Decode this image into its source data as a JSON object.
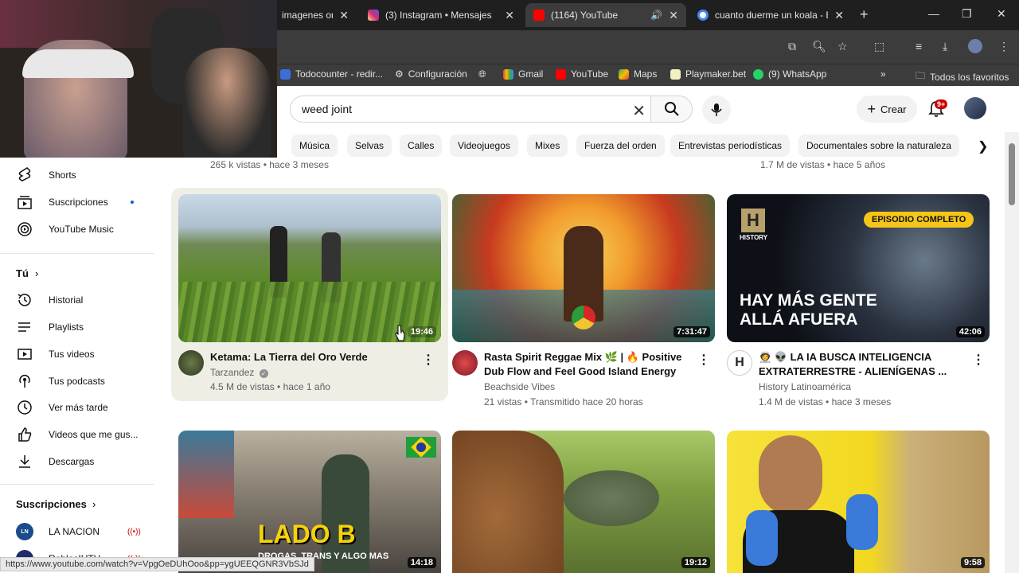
{
  "browser": {
    "tabs": [
      {
        "title": "imagenes or",
        "favicon": "image-favicon"
      },
      {
        "title": "(3) Instagram • Mensajes",
        "favicon": "instagram-favicon"
      },
      {
        "title": "(1164) YouTube",
        "favicon": "youtube-favicon"
      },
      {
        "title": "cuanto duerme un koala - B",
        "favicon": "google-favicon"
      }
    ],
    "bookmarks": [
      "Todocounter - redir...",
      "Configuración",
      "Gmail",
      "YouTube",
      "Maps",
      "Playmaker.bet",
      "(9) WhatsApp"
    ],
    "all_favorites": "Todos los favoritos",
    "status_url": "https://www.youtube.com/watch?v=VpgOeDUhOoo&pp=ygUEEQGNR3VbSJd"
  },
  "youtube": {
    "search_value": "weed joint",
    "create_label": "Crear",
    "notif_badge": "9+",
    "chips": [
      "Música",
      "Selvas",
      "Calles",
      "Videojuegos",
      "Mixes",
      "Fuerza del orden",
      "Entrevistas periodísticas",
      "Documentales sobre la naturaleza"
    ],
    "prev_row_meta_1": "265 k vistas • hace 3 meses",
    "prev_row_meta_3": "1.7 M de vistas • hace 5 años"
  },
  "sidebar": {
    "items": [
      {
        "label": "Shorts",
        "icon": "shorts-icon"
      },
      {
        "label": "Suscripciones",
        "icon": "subscriptions-icon"
      },
      {
        "label": "YouTube Music",
        "icon": "youtube-music-icon"
      }
    ],
    "you_heading": "Tú",
    "you_items": [
      {
        "label": "Historial",
        "icon": "history-icon"
      },
      {
        "label": "Playlists",
        "icon": "playlists-icon"
      },
      {
        "label": "Tus videos",
        "icon": "your-videos-icon"
      },
      {
        "label": "Tus podcasts",
        "icon": "podcasts-icon"
      },
      {
        "label": "Ver más tarde",
        "icon": "watch-later-icon"
      },
      {
        "label": "Videos que me gus...",
        "icon": "liked-icon"
      },
      {
        "label": "Descargas",
        "icon": "downloads-icon"
      }
    ],
    "subs_heading": "Suscripciones",
    "subs": [
      {
        "label": "LA NACION",
        "live": true
      },
      {
        "label": "RoblesIUTU",
        "live": true
      }
    ]
  },
  "videos": [
    {
      "title": "Ketama: La Tierra del Oro Verde",
      "channel": "Tarzandez",
      "verified": true,
      "meta": "4.5 M de vistas • hace 1 año",
      "duration": "19:46"
    },
    {
      "title": "Rasta Spirit Reggae Mix 🌿 | 🔥 Positive Dub Flow and Feel Good Island Energy",
      "channel": "Beachside Vibes",
      "verified": false,
      "meta": "21 vistas • Transmitido hace 20 horas",
      "duration": "7:31:47"
    },
    {
      "title": "🧑‍🚀 👽 LA IA BUSCA INTELIGENCIA EXTRATERRESTRE - ALIENÍGENAS ...",
      "channel": "History Latinoamérica",
      "verified": false,
      "meta": "1.4 M de vistas • hace 3 meses",
      "duration": "42:06",
      "badge": "EPISODIO COMPLETO",
      "overlay": "HAY MÁS GENTE ALLÁ AFUERA",
      "brand": "HISTORY"
    },
    {
      "title": "",
      "duration": "14:18",
      "overlay": "LADO B",
      "overlay2": "DROGAS, TRANS Y ALGO MAS"
    },
    {
      "title": "",
      "duration": "19:12"
    },
    {
      "title": "",
      "duration": "9:58"
    }
  ]
}
